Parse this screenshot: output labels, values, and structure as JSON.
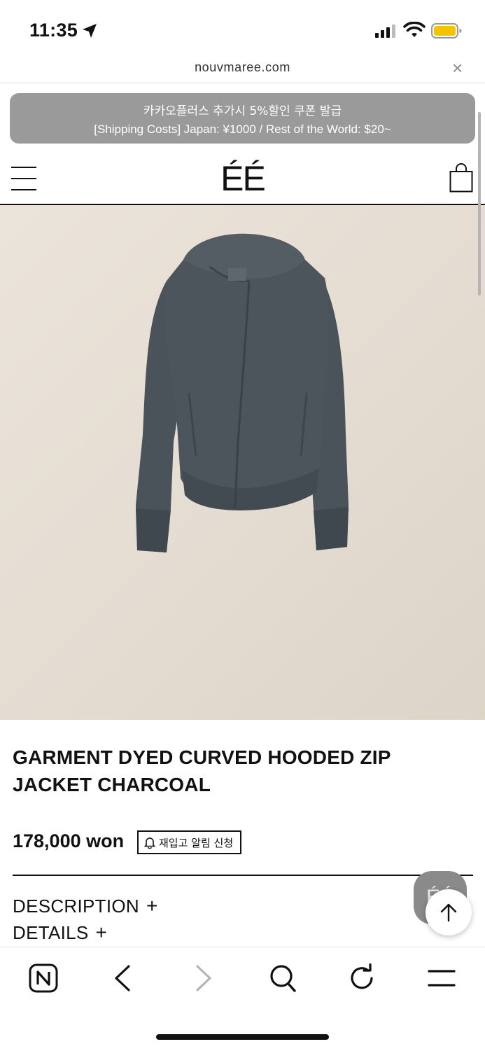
{
  "status_bar": {
    "time": "11:35",
    "battery_color": "#f5c400"
  },
  "browser": {
    "url": "nouvmaree.com",
    "close_symbol": "×"
  },
  "banner": {
    "line1": "카카오플러스 추가시 5%할인 쿠폰 발급",
    "line2": "[Shipping Costs] Japan: ¥1000 / Rest of the World: $20~"
  },
  "header": {
    "logo": "ÉÉ"
  },
  "product": {
    "title": "GARMENT DYED CURVED HOODED ZIP JACKET CHARCOAL",
    "price": "178,000 won",
    "restock_label": "재입고 알림 신청",
    "image_icon": "charcoal-hooded-zip-jacket"
  },
  "accordion": [
    {
      "label": "DESCRIPTION",
      "symbol": "+"
    },
    {
      "label": "DETAILS",
      "symbol": "+"
    }
  ],
  "floating": {
    "chat_label": "ÉÉ"
  },
  "toolbar": {
    "icons": [
      "naver-icon",
      "back-icon",
      "forward-icon",
      "search-icon",
      "refresh-icon",
      "menu-icon"
    ]
  }
}
